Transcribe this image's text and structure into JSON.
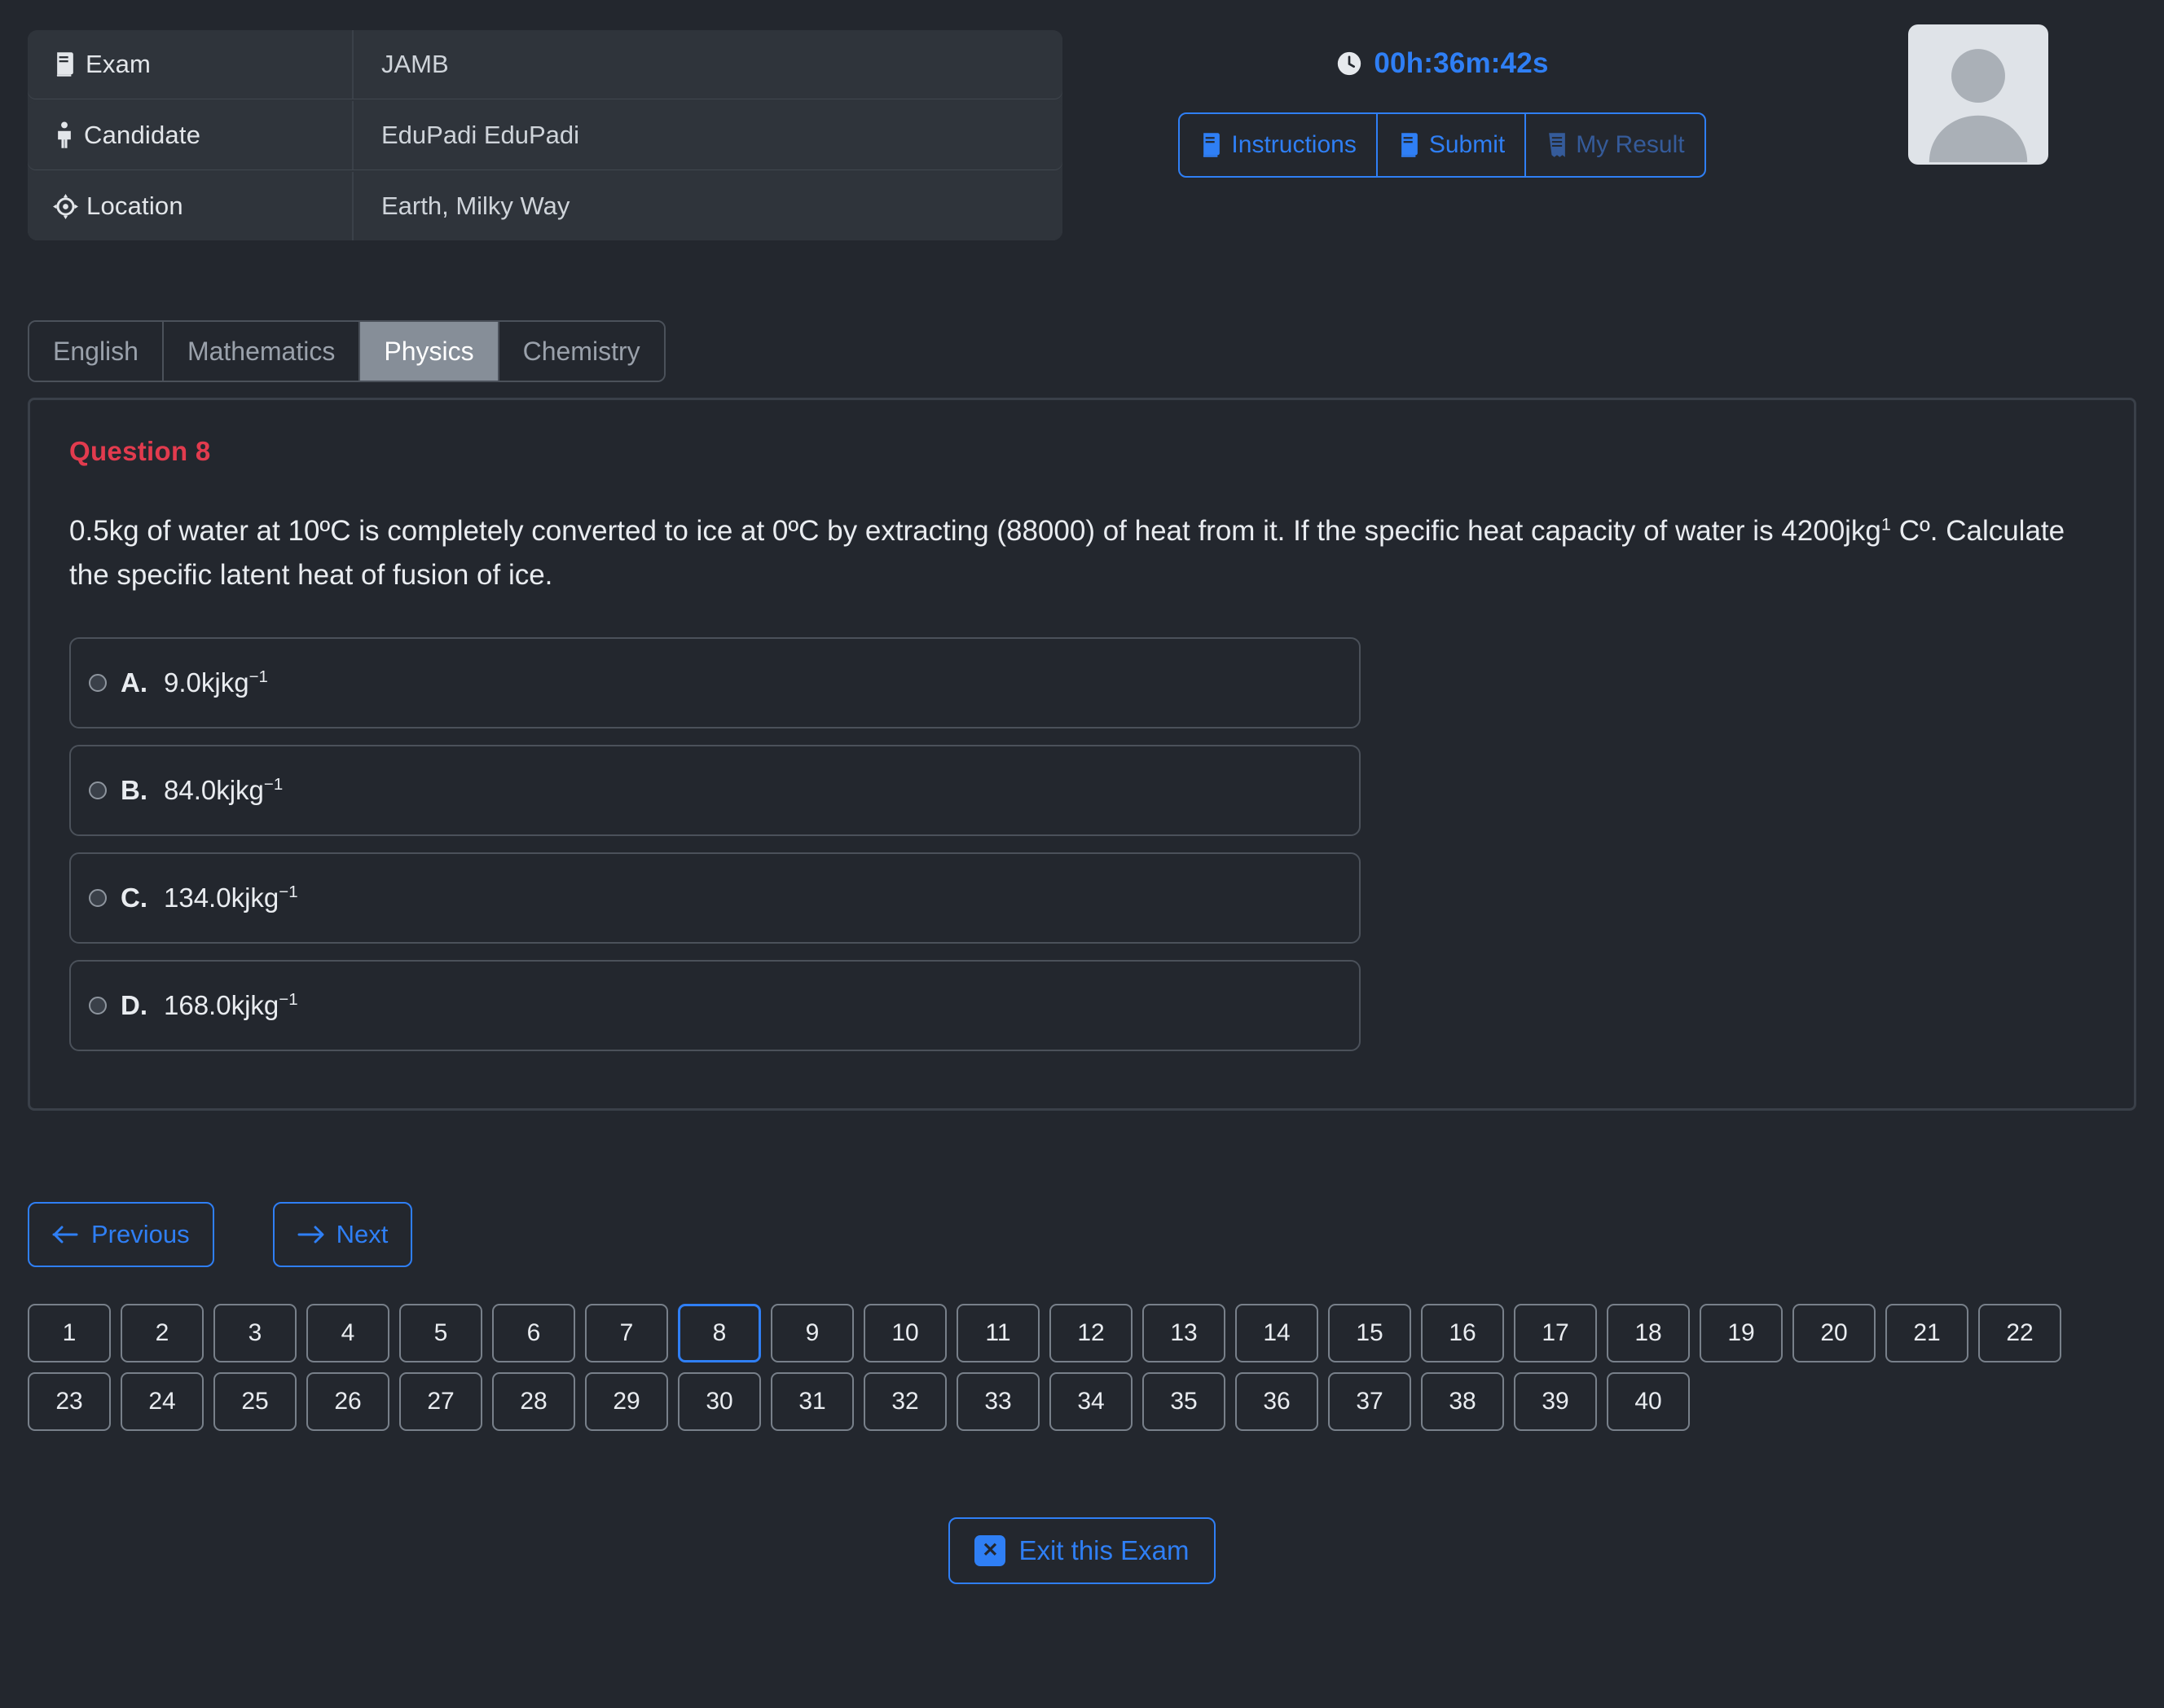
{
  "header": {
    "info_rows": [
      {
        "icon": "book-icon",
        "label": "Exam",
        "value": "JAMB"
      },
      {
        "icon": "person-icon",
        "label": "Candidate",
        "value": "EduPadi EduPadi"
      },
      {
        "icon": "location-target-icon",
        "label": "Location",
        "value": "Earth, Milky Way"
      }
    ],
    "timer": "00h:36m:42s",
    "timer_icon": "clock-icon",
    "actions": [
      {
        "icon": "book-icon",
        "label": "Instructions",
        "muted": false
      },
      {
        "icon": "book-icon",
        "label": "Submit",
        "muted": false
      },
      {
        "icon": "receipt-icon",
        "label": "My Result",
        "muted": true
      }
    ],
    "avatar_alt": "avatar-placeholder"
  },
  "tabs": [
    {
      "label": "English",
      "active": false
    },
    {
      "label": "Mathematics",
      "active": false
    },
    {
      "label": "Physics",
      "active": true
    },
    {
      "label": "Chemistry",
      "active": false
    }
  ],
  "question": {
    "title": "Question 8",
    "text_parts": [
      {
        "t": "0.5kg of water at 10ºC is completely converted to ice at 0ºC by extracting (88000) of heat from it. If the specific heat capacity of water is 4200jkg",
        "sup": false
      },
      {
        "t": "1",
        "sup": true
      },
      {
        "t": " Cº. Calculate the specific latent heat of fusion of ice.",
        "sup": false
      }
    ],
    "options": [
      {
        "letter": "A.",
        "value": "9.0kjkg",
        "sup": "−1",
        "selected": false
      },
      {
        "letter": "B.",
        "value": "84.0kjkg",
        "sup": "−1",
        "selected": false
      },
      {
        "letter": "C.",
        "value": "134.0kjkg",
        "sup": "−1",
        "selected": false
      },
      {
        "letter": "D.",
        "value": "168.0kjkg",
        "sup": "−1",
        "selected": false
      }
    ]
  },
  "nav": {
    "previous_label": "Previous",
    "previous_icon": "arrow-left-icon",
    "next_label": "Next",
    "next_icon": "arrow-right-icon"
  },
  "number_grid": {
    "current": 8,
    "numbers": [
      1,
      2,
      3,
      4,
      5,
      6,
      7,
      8,
      9,
      10,
      11,
      12,
      13,
      14,
      15,
      16,
      17,
      18,
      19,
      20,
      21,
      22,
      23,
      24,
      25,
      26,
      27,
      28,
      29,
      30,
      31,
      32,
      33,
      34,
      35,
      36,
      37,
      38,
      39,
      40
    ]
  },
  "exit": {
    "label": "Exit this Exam",
    "icon": "close-box-icon",
    "glyph": "✕"
  },
  "colors": {
    "background": "#23272e",
    "panel": "#2f343b",
    "accent_blue": "#2f7ff5",
    "question_red": "#e23b4e",
    "active_tab_bg": "#868e98",
    "border_gray": "#4b515a"
  }
}
